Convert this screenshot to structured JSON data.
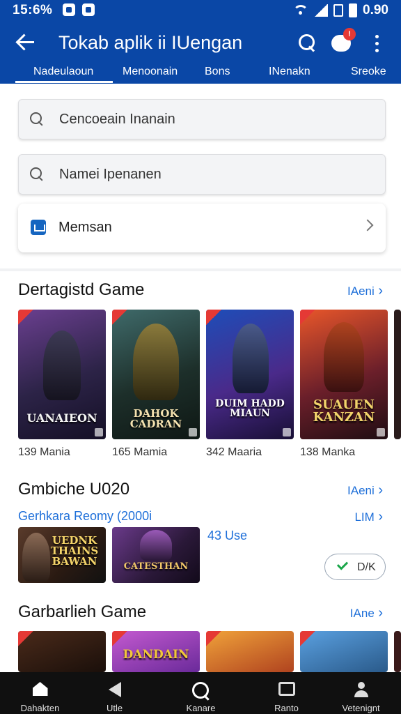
{
  "status": {
    "time": "15:6%",
    "right_text": "0.90"
  },
  "appbar": {
    "title": "Tokab aplik ii IUengan",
    "chat_badge": "!"
  },
  "tabs": [
    {
      "label": "Nadeulaoun"
    },
    {
      "label": "Menoonain"
    },
    {
      "label": "Bons"
    },
    {
      "label": "INenakn"
    },
    {
      "label": "Sreoke"
    }
  ],
  "fields": {
    "search_primary": "Cencoeain Inanain",
    "search_secondary": "Namei Ipenanen"
  },
  "message_card": {
    "label": "Memsan"
  },
  "section1": {
    "title": "Dertagistd Game",
    "link": "IAeni",
    "games": [
      {
        "art_title": "UANAIEON",
        "caption": "139 Mania"
      },
      {
        "art_title": "DAHOK CADRAN",
        "caption": "165 Mamia"
      },
      {
        "art_title": "DUIM HADD MIAUN",
        "caption": "342 Maaria"
      },
      {
        "art_title": "SUAUEN KANZAN",
        "caption": "138 Manka"
      }
    ]
  },
  "section2": {
    "title": "Gmbiche U020",
    "link": "IAeni",
    "subtitle": "Gerhkara Reomy (2000i",
    "sub_link": "LIM",
    "size_text": "43 Use",
    "ok_label": "D/K",
    "games": [
      {
        "art_title": "UEDNK THAINS BAWAN"
      },
      {
        "art_title": "CATESTHAN"
      }
    ]
  },
  "section3": {
    "title": "Garbarlieh Game",
    "link": "IAne",
    "games": [
      {
        "art_title": ""
      },
      {
        "art_title": "DANDAIN"
      },
      {
        "art_title": ""
      },
      {
        "art_title": ""
      }
    ]
  },
  "bottom_nav": [
    {
      "label": "Dahakten",
      "icon": "home-icon"
    },
    {
      "label": "Utle",
      "icon": "back-icon"
    },
    {
      "label": "Kanare",
      "icon": "search-icon"
    },
    {
      "label": "Ranto",
      "icon": "square-icon"
    },
    {
      "label": "Vetenignt",
      "icon": "person-icon"
    }
  ],
  "colors": {
    "app_bar": "#0a47a6",
    "link": "#1e6fd9",
    "bottom_nav": "#101010",
    "badge": "#e53935",
    "check": "#1aa64a"
  }
}
